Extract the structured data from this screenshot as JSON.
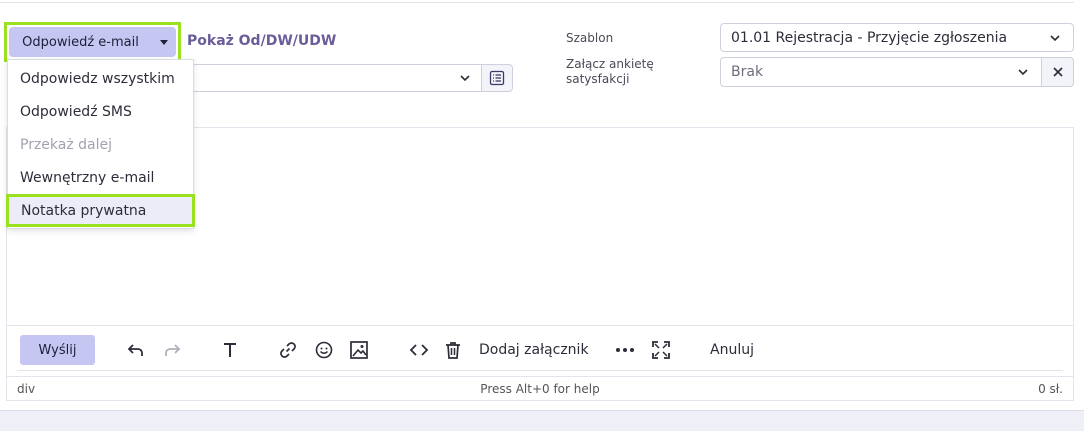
{
  "reply_button": {
    "label": "Odpowiedź e-mail"
  },
  "show_link": "Pokaż Od/DW/UDW",
  "reply_menu": {
    "items": [
      {
        "label": "Odpowiedz wszystkim",
        "state": "normal"
      },
      {
        "label": "Odpowiedź SMS",
        "state": "normal"
      },
      {
        "label": "Przekaż dalej",
        "state": "disabled"
      },
      {
        "label": "Wewnętrzny e-mail",
        "state": "normal"
      },
      {
        "label": "Notatka prywatna",
        "state": "selected"
      }
    ]
  },
  "template": {
    "label": "Szablon",
    "value": "01.01 Rejestracja - Przyjęcie zgłoszenia"
  },
  "survey": {
    "label_line1": "Załącz ankietę",
    "label_line2": "satysfakcji",
    "value": "Brak"
  },
  "toolbar": {
    "send_label": "Wyślij",
    "attach_label": "Dodaj załącznik",
    "cancel_label": "Anuluj"
  },
  "statusbar": {
    "path": "div",
    "help": "Press Alt+0 for help",
    "word_count": "0 sł."
  },
  "colors": {
    "accent_purple": "#c5c6f1",
    "highlight_green": "#9ae11f",
    "link_purple": "#6b5c9a"
  }
}
